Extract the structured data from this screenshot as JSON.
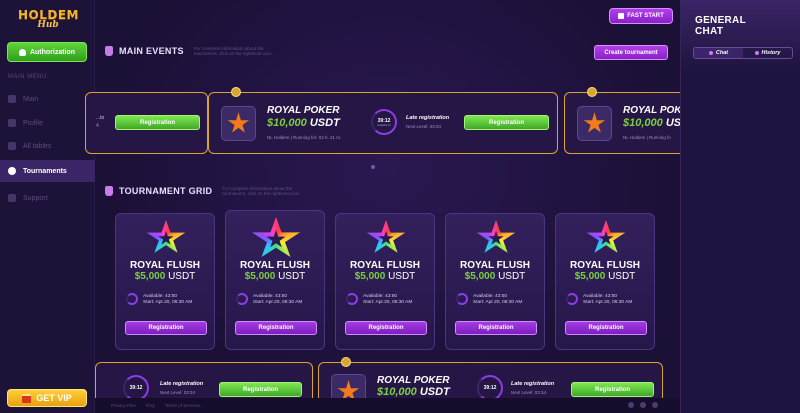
{
  "sidebar": {
    "logo_top": "HOLDEM",
    "logo_bottom": "Hub",
    "auth_button": "Authorization",
    "menu_label": "MAIN MENU",
    "items": [
      {
        "label": "Main"
      },
      {
        "label": "Profile"
      },
      {
        "label": "All tables"
      },
      {
        "label": "Tournaments"
      },
      {
        "label": "Support"
      }
    ],
    "vip_button": "GET VIP"
  },
  "header": {
    "fast_start": "FAST START"
  },
  "main_events": {
    "title": "MAIN EVENTS",
    "note": "For complete information about the tournament, click on the rightmost icon.",
    "create_button": "Create tournament",
    "left_partial": {
      "info": "...to",
      "sub": "4",
      "reg_button": "Registration"
    },
    "center": {
      "title": "ROYAL POKER",
      "prize_amount": "$10,000",
      "prize_currency": "USDT",
      "info": "NL Holdem | Running for: 02 h. 21 m.",
      "timer": "39:12",
      "timer_sub": "Available for",
      "late_label": "Late registration",
      "next_level": "Next Level: 03:34",
      "reg_button": "Registration"
    },
    "right_partial": {
      "title": "ROYAL POK",
      "prize_amount": "$10,000",
      "prize_currency": "USD",
      "info": "NL Holdem | Running fo"
    }
  },
  "tournament_grid": {
    "title": "TOURNAMENT GRID",
    "note": "For complete information about the tournament, click on the rightmost icon.",
    "cards": [
      {
        "title": "ROYAL FLUSH",
        "amount": "$5,000",
        "currency": "USDT",
        "available": "Available: 43:50",
        "start": "Start: Apr.20, 06:30 AM",
        "button": "Registration"
      },
      {
        "title": "ROYAL FLUSH",
        "amount": "$5,000",
        "currency": "USDT",
        "available": "Available: 43:50",
        "start": "Start: Apr.20, 06:30 AM",
        "button": "Registration"
      },
      {
        "title": "ROYAL FLUSH",
        "amount": "$5,000",
        "currency": "USDT",
        "available": "Available: 43:50",
        "start": "Start: Apr.20, 06:30 AM",
        "button": "Registration"
      },
      {
        "title": "ROYAL FLUSH",
        "amount": "$5,000",
        "currency": "USDT",
        "available": "Available: 43:50",
        "start": "Start: Apr.20, 06:30 AM",
        "button": "Registration"
      },
      {
        "title": "ROYAL FLUSH",
        "amount": "$5,000",
        "currency": "USDT",
        "available": "Available: 43:50",
        "start": "Start: Apr.20, 06:30 AM",
        "button": "Registration"
      }
    ]
  },
  "bottom_events": {
    "left": {
      "timer": "39:12",
      "late_label": "Late registration",
      "next_level": "Next Level: 03:34",
      "reg_button": "Registration"
    },
    "center": {
      "title": "ROYAL POKER",
      "prize_amount": "$10,000",
      "prize_currency": "USDT",
      "timer": "39:12",
      "late_label": "Late registration",
      "next_level": "Next Level: 03:34",
      "reg_button": "Registration"
    }
  },
  "footer": {
    "links": [
      "Privacy Plus",
      "FAQ",
      "Terms of Services"
    ]
  },
  "chat": {
    "title_line1": "GENERAL",
    "title_line2": "CHAT",
    "tab_chat": "Chat",
    "tab_history": "History"
  },
  "colors": {
    "accent_purple": "#8a22c9",
    "accent_green": "#3fa829",
    "accent_gold": "#d8a531",
    "prize_green": "#7bd13d",
    "background": "#1a0f33"
  }
}
